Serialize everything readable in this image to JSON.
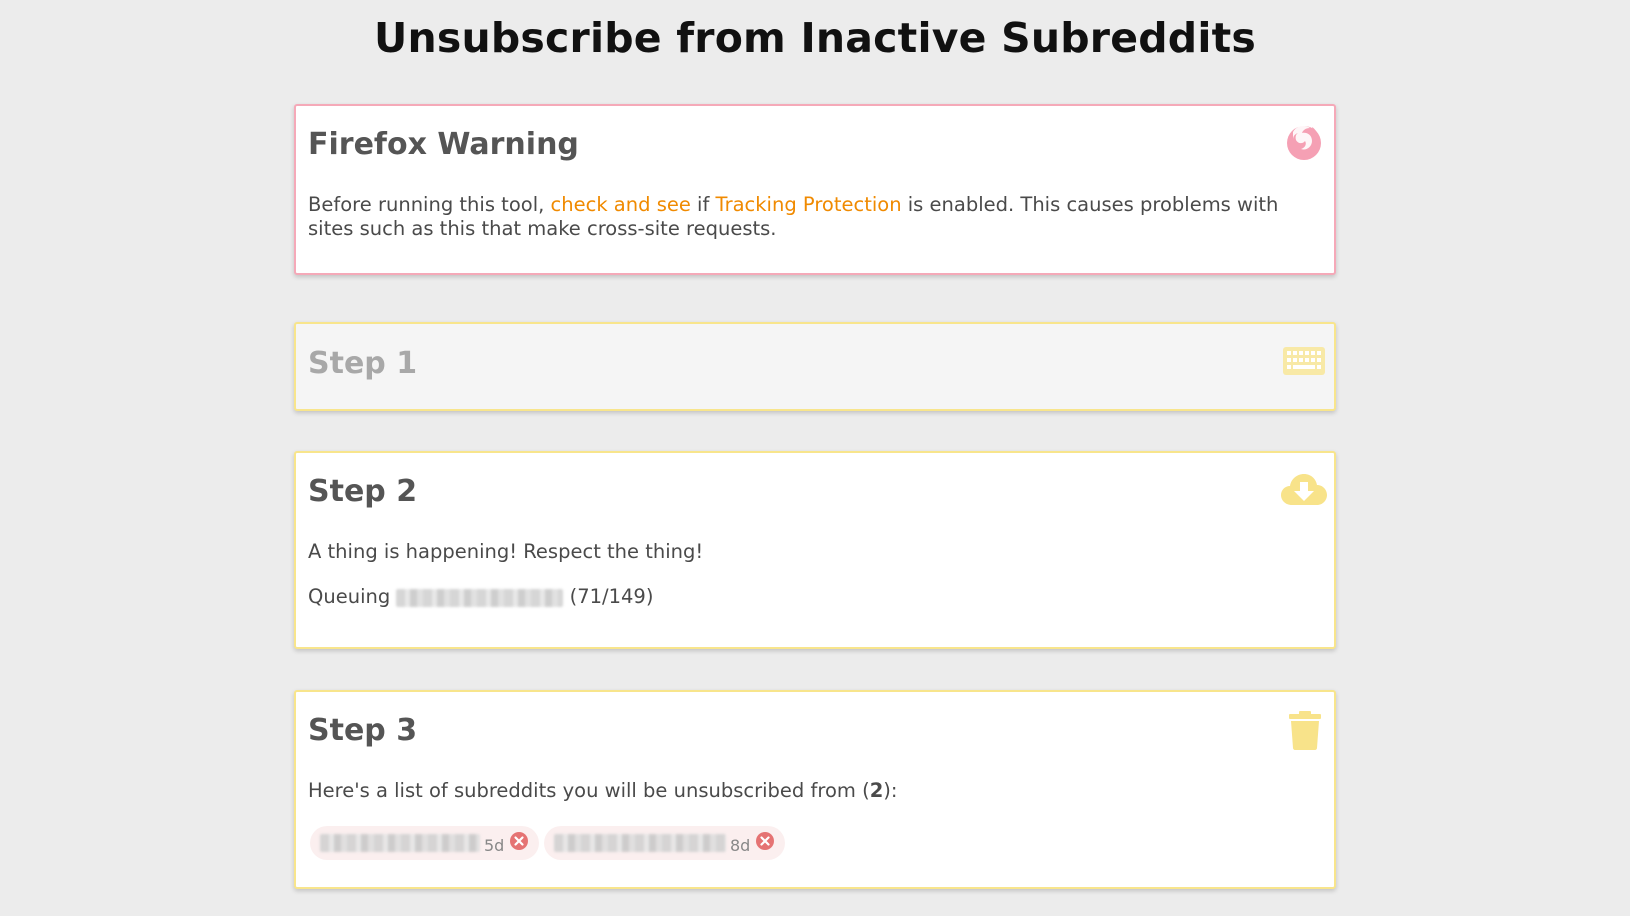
{
  "page": {
    "title": "Unsubscribe from Inactive Subreddits"
  },
  "warning": {
    "heading": "Firefox Warning",
    "text_before": "Before running this tool, ",
    "link1": "check and see",
    "text_middle": " if ",
    "link2": "Tracking Protection",
    "text_after": " is enabled. This causes problems with sites such as this that make cross-site requests.",
    "icon": "firefox-icon"
  },
  "step1": {
    "heading": "Step 1",
    "icon": "keyboard-icon"
  },
  "step2": {
    "heading": "Step 2",
    "message": "A thing is happening! Respect the thing!",
    "status_prefix": "Queuing",
    "status_progress": "(71/149)",
    "icon": "cloud-download-icon"
  },
  "step3": {
    "heading": "Step 3",
    "list_text_before": "Here's a list of subreddits you will be unsubscribed from (",
    "list_count": "2",
    "list_text_after": "):",
    "icon": "trash-icon",
    "subreddits": [
      {
        "age": "5d"
      },
      {
        "age": "8d"
      }
    ]
  },
  "colors": {
    "accent_link": "#f08a00",
    "warning_border": "#f5a9b8",
    "step_border": "#f8e58c",
    "icon_yellow": "#f8e38a",
    "icon_pink": "#f5a0b4",
    "remove_red": "#e57373"
  }
}
